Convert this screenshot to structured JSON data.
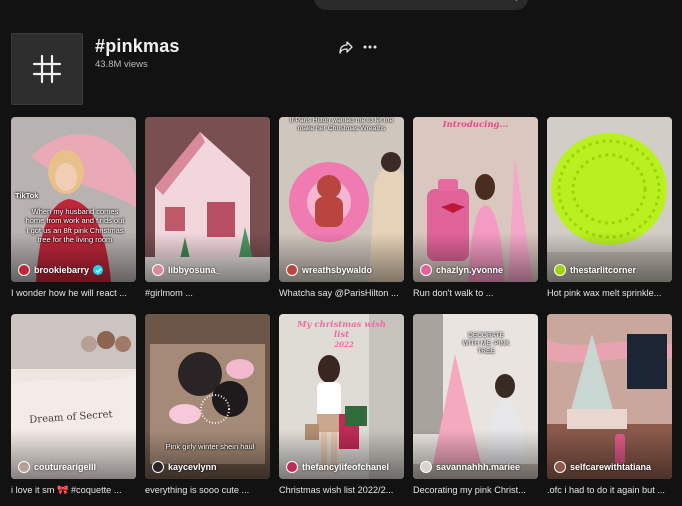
{
  "header": {
    "title": "#pinkmas",
    "views": "43.8M views"
  },
  "videos": [
    {
      "author": "brookiebarry",
      "verified": true,
      "caption": "I wonder how he will react ...",
      "overlay": "When my husband comes home from work and finds out I got us an 8ft pink Christmas tree for the living room",
      "watermark": "TikTok",
      "colors": [
        "#b8b2b0",
        "#e9a9b6",
        "#c0263a"
      ]
    },
    {
      "author": "libbyosuna_",
      "verified": false,
      "caption": "#girlmom ...",
      "colors": [
        "#8a5a5e",
        "#f1d7dc",
        "#d98a9a"
      ]
    },
    {
      "author": "wreathsbywaldo",
      "verified": false,
      "caption": "Whatcha say @ParisHilton ...",
      "overlay": "If Paris Hilton wanted me to let me make her Christmas Wreaths",
      "colors": [
        "#cfc7bd",
        "#f07bb1",
        "#b8463e"
      ]
    },
    {
      "author": "chazlyn.yvonne",
      "verified": false,
      "caption": "Run don't walk to ...",
      "overlay": "Introducing...",
      "colors": [
        "#d9c7c0",
        "#f5a7c9",
        "#e0639a"
      ]
    },
    {
      "author": "thestarlitcorner",
      "verified": false,
      "caption": "Hot pink wax melt sprinkle...",
      "colors": [
        "#d2cdc6",
        "#b9f020",
        "#9fd10e"
      ]
    },
    {
      "author": "couturearigelll",
      "verified": false,
      "caption": "i love it sm 🎀 #coquette ...",
      "overlay": "Dream of Secret",
      "colors": [
        "#cbc4c0",
        "#efe6e2",
        "#b69f95"
      ]
    },
    {
      "author": "kaycevlynn",
      "verified": false,
      "caption": "everything is sooo cute ...",
      "overlay": "Pink girly winter shein haul",
      "colors": [
        "#a58a77",
        "#f3b9cf",
        "#2a2426"
      ]
    },
    {
      "author": "thefancylifeofchanel",
      "verified": false,
      "caption": "Christmas wish list 2022/2...",
      "overlay": "My christmas wish list",
      "overlay2": "2022",
      "colors": [
        "#dfdcd6",
        "#ffffff",
        "#c02a56"
      ]
    },
    {
      "author": "savannahhh.mariee",
      "verified": false,
      "caption": "Decorating my pink Christ...",
      "overlay": "DECORATE WITH ME: PINK TREE",
      "colors": [
        "#e9e4df",
        "#f4a9bf",
        "#d9d4cd"
      ]
    },
    {
      "author": "selfcarewithtatiana",
      "verified": false,
      "caption": ".ofc i had to do it again but ...",
      "colors": [
        "#d3c2bd",
        "#e7a3b0",
        "#8a5a4b"
      ]
    }
  ]
}
